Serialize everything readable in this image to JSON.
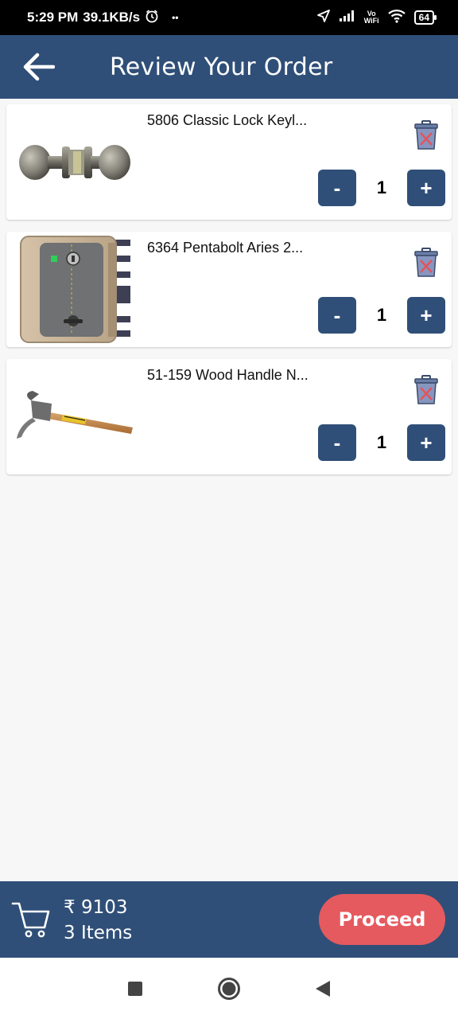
{
  "status_bar": {
    "time": "5:29 PM",
    "speed": "39.1KB/s",
    "dots": "••",
    "vowifi_top": "Vo",
    "vowifi_bottom": "WiFi",
    "battery": "64",
    "icons": [
      "alarm-icon",
      "location-arrow-icon",
      "signal-icon",
      "wifi-icon",
      "battery-icon"
    ]
  },
  "header": {
    "title": "Review Your Order",
    "back_icon": "arrow-left-icon"
  },
  "cart_items": [
    {
      "name": "5806 Classic Lock Keyl...",
      "quantity": "1",
      "image": "door-knob-lock"
    },
    {
      "name": "6364 Pentabolt Aries 2...",
      "quantity": "1",
      "image": "pentabolt-lock"
    },
    {
      "name": "51-159 Wood Handle N...",
      "quantity": "1",
      "image": "claw-hammer"
    }
  ],
  "stepper": {
    "minus": "-",
    "plus": "+"
  },
  "footer": {
    "total_price": "₹ 9103",
    "item_count": "3 Items",
    "proceed_label": "Proceed"
  },
  "colors": {
    "primary": "#2f4f78",
    "accent": "#e55a5f",
    "background": "#f7f7f7"
  },
  "nav": [
    "recents-square-icon",
    "home-circle-icon",
    "back-triangle-icon"
  ]
}
